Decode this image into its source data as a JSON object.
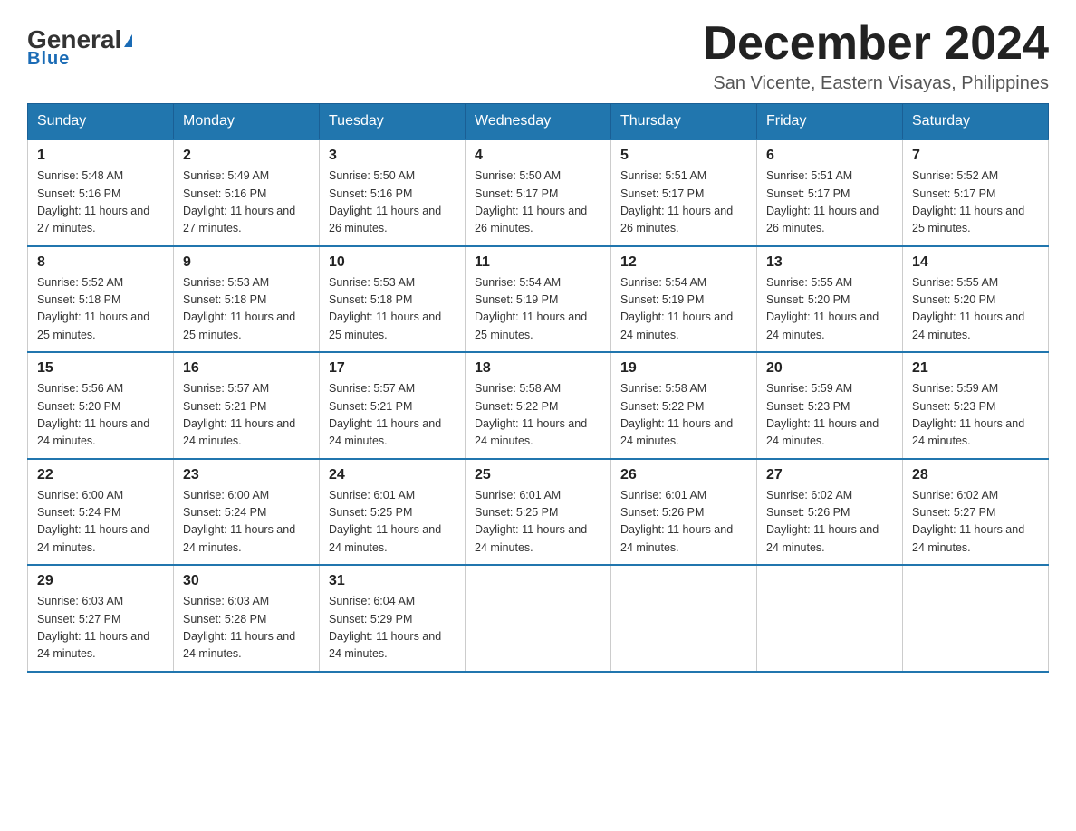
{
  "logo": {
    "general": "General",
    "blue": "Blue",
    "triangle": "▶"
  },
  "header": {
    "month": "December 2024",
    "location": "San Vicente, Eastern Visayas, Philippines"
  },
  "days_header": [
    "Sunday",
    "Monday",
    "Tuesday",
    "Wednesday",
    "Thursday",
    "Friday",
    "Saturday"
  ],
  "weeks": [
    [
      {
        "day": "1",
        "sunrise": "5:48 AM",
        "sunset": "5:16 PM",
        "daylight": "11 hours and 27 minutes."
      },
      {
        "day": "2",
        "sunrise": "5:49 AM",
        "sunset": "5:16 PM",
        "daylight": "11 hours and 27 minutes."
      },
      {
        "day": "3",
        "sunrise": "5:50 AM",
        "sunset": "5:16 PM",
        "daylight": "11 hours and 26 minutes."
      },
      {
        "day": "4",
        "sunrise": "5:50 AM",
        "sunset": "5:17 PM",
        "daylight": "11 hours and 26 minutes."
      },
      {
        "day": "5",
        "sunrise": "5:51 AM",
        "sunset": "5:17 PM",
        "daylight": "11 hours and 26 minutes."
      },
      {
        "day": "6",
        "sunrise": "5:51 AM",
        "sunset": "5:17 PM",
        "daylight": "11 hours and 26 minutes."
      },
      {
        "day": "7",
        "sunrise": "5:52 AM",
        "sunset": "5:17 PM",
        "daylight": "11 hours and 25 minutes."
      }
    ],
    [
      {
        "day": "8",
        "sunrise": "5:52 AM",
        "sunset": "5:18 PM",
        "daylight": "11 hours and 25 minutes."
      },
      {
        "day": "9",
        "sunrise": "5:53 AM",
        "sunset": "5:18 PM",
        "daylight": "11 hours and 25 minutes."
      },
      {
        "day": "10",
        "sunrise": "5:53 AM",
        "sunset": "5:18 PM",
        "daylight": "11 hours and 25 minutes."
      },
      {
        "day": "11",
        "sunrise": "5:54 AM",
        "sunset": "5:19 PM",
        "daylight": "11 hours and 25 minutes."
      },
      {
        "day": "12",
        "sunrise": "5:54 AM",
        "sunset": "5:19 PM",
        "daylight": "11 hours and 24 minutes."
      },
      {
        "day": "13",
        "sunrise": "5:55 AM",
        "sunset": "5:20 PM",
        "daylight": "11 hours and 24 minutes."
      },
      {
        "day": "14",
        "sunrise": "5:55 AM",
        "sunset": "5:20 PM",
        "daylight": "11 hours and 24 minutes."
      }
    ],
    [
      {
        "day": "15",
        "sunrise": "5:56 AM",
        "sunset": "5:20 PM",
        "daylight": "11 hours and 24 minutes."
      },
      {
        "day": "16",
        "sunrise": "5:57 AM",
        "sunset": "5:21 PM",
        "daylight": "11 hours and 24 minutes."
      },
      {
        "day": "17",
        "sunrise": "5:57 AM",
        "sunset": "5:21 PM",
        "daylight": "11 hours and 24 minutes."
      },
      {
        "day": "18",
        "sunrise": "5:58 AM",
        "sunset": "5:22 PM",
        "daylight": "11 hours and 24 minutes."
      },
      {
        "day": "19",
        "sunrise": "5:58 AM",
        "sunset": "5:22 PM",
        "daylight": "11 hours and 24 minutes."
      },
      {
        "day": "20",
        "sunrise": "5:59 AM",
        "sunset": "5:23 PM",
        "daylight": "11 hours and 24 minutes."
      },
      {
        "day": "21",
        "sunrise": "5:59 AM",
        "sunset": "5:23 PM",
        "daylight": "11 hours and 24 minutes."
      }
    ],
    [
      {
        "day": "22",
        "sunrise": "6:00 AM",
        "sunset": "5:24 PM",
        "daylight": "11 hours and 24 minutes."
      },
      {
        "day": "23",
        "sunrise": "6:00 AM",
        "sunset": "5:24 PM",
        "daylight": "11 hours and 24 minutes."
      },
      {
        "day": "24",
        "sunrise": "6:01 AM",
        "sunset": "5:25 PM",
        "daylight": "11 hours and 24 minutes."
      },
      {
        "day": "25",
        "sunrise": "6:01 AM",
        "sunset": "5:25 PM",
        "daylight": "11 hours and 24 minutes."
      },
      {
        "day": "26",
        "sunrise": "6:01 AM",
        "sunset": "5:26 PM",
        "daylight": "11 hours and 24 minutes."
      },
      {
        "day": "27",
        "sunrise": "6:02 AM",
        "sunset": "5:26 PM",
        "daylight": "11 hours and 24 minutes."
      },
      {
        "day": "28",
        "sunrise": "6:02 AM",
        "sunset": "5:27 PM",
        "daylight": "11 hours and 24 minutes."
      }
    ],
    [
      {
        "day": "29",
        "sunrise": "6:03 AM",
        "sunset": "5:27 PM",
        "daylight": "11 hours and 24 minutes."
      },
      {
        "day": "30",
        "sunrise": "6:03 AM",
        "sunset": "5:28 PM",
        "daylight": "11 hours and 24 minutes."
      },
      {
        "day": "31",
        "sunrise": "6:04 AM",
        "sunset": "5:29 PM",
        "daylight": "11 hours and 24 minutes."
      },
      null,
      null,
      null,
      null
    ]
  ]
}
